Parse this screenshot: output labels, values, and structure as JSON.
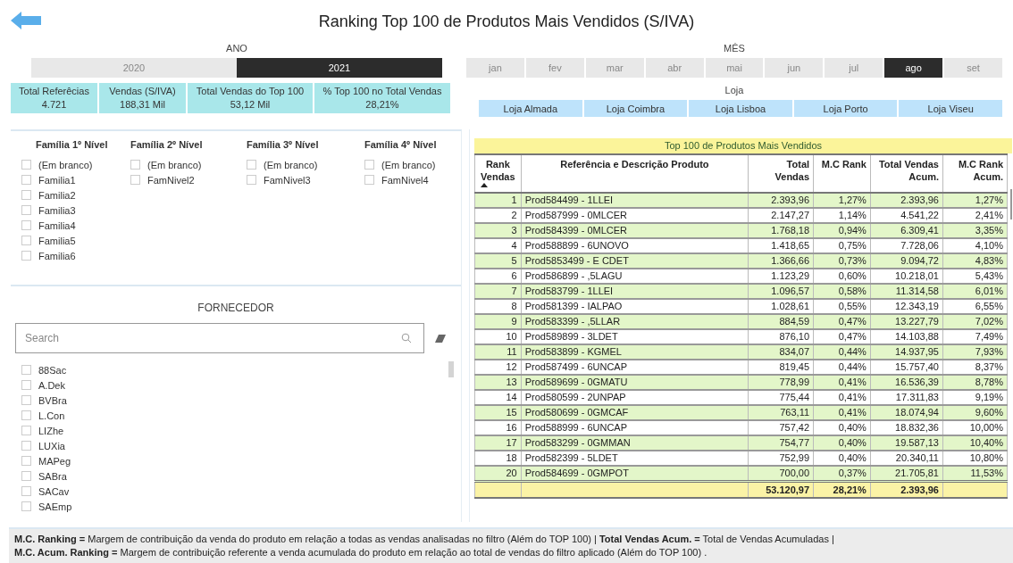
{
  "title": "Ranking Top 100 de Produtos Mais Vendidos (S/IVA)",
  "year_filter": {
    "label": "ANO",
    "options": [
      {
        "label": "2020",
        "selected": false
      },
      {
        "label": "2021",
        "selected": true
      }
    ]
  },
  "month_filter": {
    "label": "MÊS",
    "options": [
      {
        "label": "jan",
        "selected": false
      },
      {
        "label": "fev",
        "selected": false
      },
      {
        "label": "mar",
        "selected": false
      },
      {
        "label": "abr",
        "selected": false
      },
      {
        "label": "mai",
        "selected": false
      },
      {
        "label": "jun",
        "selected": false
      },
      {
        "label": "jul",
        "selected": false
      },
      {
        "label": "ago",
        "selected": true
      },
      {
        "label": "set",
        "selected": false
      }
    ]
  },
  "kpis": [
    {
      "label": "Total Referêcias",
      "value": "4.721"
    },
    {
      "label": "Vendas (S/IVA)",
      "value": "188,31 Mil"
    },
    {
      "label": "Total Vendas do Top 100",
      "value": "53,12 Mil"
    },
    {
      "label": "% Top 100 no Total Vendas",
      "value": "28,21%"
    }
  ],
  "store_filter": {
    "label": "Loja",
    "options": [
      {
        "label": "Loja Almada",
        "selected": false
      },
      {
        "label": "Loja Coimbra",
        "selected": false
      },
      {
        "label": "Loja Lisboa",
        "selected": false
      },
      {
        "label": "Loja Porto",
        "selected": false
      },
      {
        "label": "Loja Viseu",
        "selected": false
      }
    ]
  },
  "family_filters": [
    {
      "title": "Família 1º Nível",
      "items": [
        {
          "label": "(Em branco)",
          "checked": false
        },
        {
          "label": "Familia1",
          "checked": false
        },
        {
          "label": "Familia2",
          "checked": false
        },
        {
          "label": "Familia3",
          "checked": false
        },
        {
          "label": "Familia4",
          "checked": false
        },
        {
          "label": "Familia5",
          "checked": false
        },
        {
          "label": "Familia6",
          "checked": false
        }
      ]
    },
    {
      "title": "Família 2º Nível",
      "items": [
        {
          "label": "(Em branco)",
          "checked": false
        },
        {
          "label": "FamNivel2",
          "checked": false
        }
      ]
    },
    {
      "title": "Família 3º Nível",
      "items": [
        {
          "label": "(Em branco)",
          "checked": false
        },
        {
          "label": "FamNivel3",
          "checked": false
        }
      ]
    },
    {
      "title": "Família 4º Nível",
      "items": [
        {
          "label": "(Em branco)",
          "checked": false
        },
        {
          "label": "FamNivel4",
          "checked": false
        }
      ]
    }
  ],
  "supplier_filter": {
    "title": "FORNECEDOR",
    "search": {
      "placeholder": "Search"
    },
    "items": [
      {
        "label": "88Sac",
        "checked": false
      },
      {
        "label": "A.Dek",
        "checked": false
      },
      {
        "label": "BVBra",
        "checked": false
      },
      {
        "label": "L.Con",
        "checked": false
      },
      {
        "label": "LIZhe",
        "checked": false
      },
      {
        "label": "LUXia",
        "checked": false
      },
      {
        "label": "MAPeg",
        "checked": false
      },
      {
        "label": "SABra",
        "checked": false
      },
      {
        "label": "SACav",
        "checked": false
      },
      {
        "label": "SAEmp",
        "checked": false
      }
    ]
  },
  "table": {
    "title": "Top 100 de Produtos Mais Vendidos",
    "columns": [
      "Rank Vendas",
      "Referência e Descrição Produto",
      "Total Vendas",
      "M.C Rank",
      "Total Vendas Acum.",
      "M.C Rank Acum."
    ],
    "rows": [
      [
        "1",
        "Prod584499 - 1LLEI",
        "2.393,96",
        "1,27%",
        "2.393,96",
        "1,27%"
      ],
      [
        "2",
        "Prod587999 - 0MLCER",
        "2.147,27",
        "1,14%",
        "4.541,22",
        "2,41%"
      ],
      [
        "3",
        "Prod584399 - 0MLCER",
        "1.768,18",
        "0,94%",
        "6.309,41",
        "3,35%"
      ],
      [
        "4",
        "Prod588899 - 6UNOVO",
        "1.418,65",
        "0,75%",
        "7.728,06",
        "4,10%"
      ],
      [
        "5",
        "Prod5853499 - E CDET",
        "1.366,66",
        "0,73%",
        "9.094,72",
        "4,83%"
      ],
      [
        "6",
        "Prod586899 - ,5LAGU",
        "1.123,29",
        "0,60%",
        "10.218,01",
        "5,43%"
      ],
      [
        "7",
        "Prod583799 - 1LLEI",
        "1.096,57",
        "0,58%",
        "11.314,58",
        "6,01%"
      ],
      [
        "8",
        "Prod581399 - IALPAO",
        "1.028,61",
        "0,55%",
        "12.343,19",
        "6,55%"
      ],
      [
        "9",
        "Prod583399 - ,5LLAR",
        "884,59",
        "0,47%",
        "13.227,79",
        "7,02%"
      ],
      [
        "10",
        "Prod589899 - 3LDET",
        "876,10",
        "0,47%",
        "14.103,88",
        "7,49%"
      ],
      [
        "11",
        "Prod583899 - KGMEL",
        "834,07",
        "0,44%",
        "14.937,95",
        "7,93%"
      ],
      [
        "12",
        "Prod587499 - 6UNCAP",
        "819,45",
        "0,44%",
        "15.757,40",
        "8,37%"
      ],
      [
        "13",
        "Prod589699 - 0GMATU",
        "778,99",
        "0,41%",
        "16.536,39",
        "8,78%"
      ],
      [
        "14",
        "Prod580599 - 2UNPAP",
        "775,44",
        "0,41%",
        "17.311,83",
        "9,19%"
      ],
      [
        "15",
        "Prod580699 - 0GMCAF",
        "763,11",
        "0,41%",
        "18.074,94",
        "9,60%"
      ],
      [
        "16",
        "Prod588999 - 6UNCAP",
        "757,42",
        "0,40%",
        "18.832,36",
        "10,00%"
      ],
      [
        "17",
        "Prod583299 - 0GMMAN",
        "754,77",
        "0,40%",
        "19.587,13",
        "10,40%"
      ],
      [
        "18",
        "Prod582399 - 5LDET",
        "752,99",
        "0,40%",
        "20.340,11",
        "10,80%"
      ],
      [
        "20",
        "Prod584699 - 0GMPOT",
        "700,00",
        "0,37%",
        "21.705,81",
        "11,53%"
      ]
    ],
    "totals": {
      "total_vendas": "53.120,97",
      "mc_rank": "28,21%",
      "total_vendas_acum": "2.393,96"
    }
  },
  "footer": {
    "lines": [
      "**M.C. Ranking =** Margem de contribuição da venda do produto em relação a todas as vendas analisadas no filtro (Além do TOP 100) | **Total Vendas Acum. =** Total de Vendas Acumuladas |",
      "**M.C. Acum. Ranking =** Margem de contribuição referente a venda acumulada do produto em relação ao total de vendas do filtro aplicado (Além do TOP 100) ."
    ]
  }
}
